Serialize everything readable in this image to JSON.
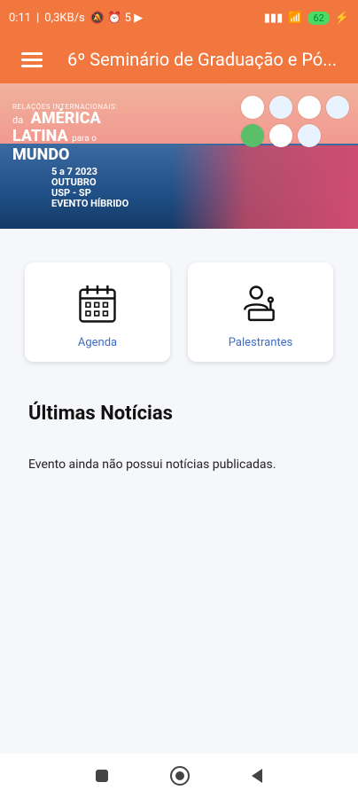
{
  "status_bar": {
    "time": "0:11",
    "net": "0,3KB/s",
    "battery": "62"
  },
  "app_bar": {
    "title": "6º Seminário de Graduação e Pó..."
  },
  "banner": {
    "subtitle": "RELAÇÕES INTERNACIONAIS:",
    "line1_prefix": "da",
    "line1": "AMÉRICA",
    "line2": "LATINA",
    "line2_suffix": "para o",
    "line3": "MUNDO",
    "dates_top": "5 a 7 2023",
    "dates_month": "OUTUBRO",
    "location": "USP - SP",
    "note": "EVENTO HÍBRIDO"
  },
  "cards": [
    {
      "label": "Agenda",
      "icon": "calendar-icon"
    },
    {
      "label": "Palestrantes",
      "icon": "speaker-podium-icon"
    }
  ],
  "news": {
    "title": "Últimas Notícias",
    "empty_text": "Evento ainda não possui notícias publicadas."
  },
  "colors": {
    "accent": "#f2773e",
    "link": "#3f6cc6"
  }
}
